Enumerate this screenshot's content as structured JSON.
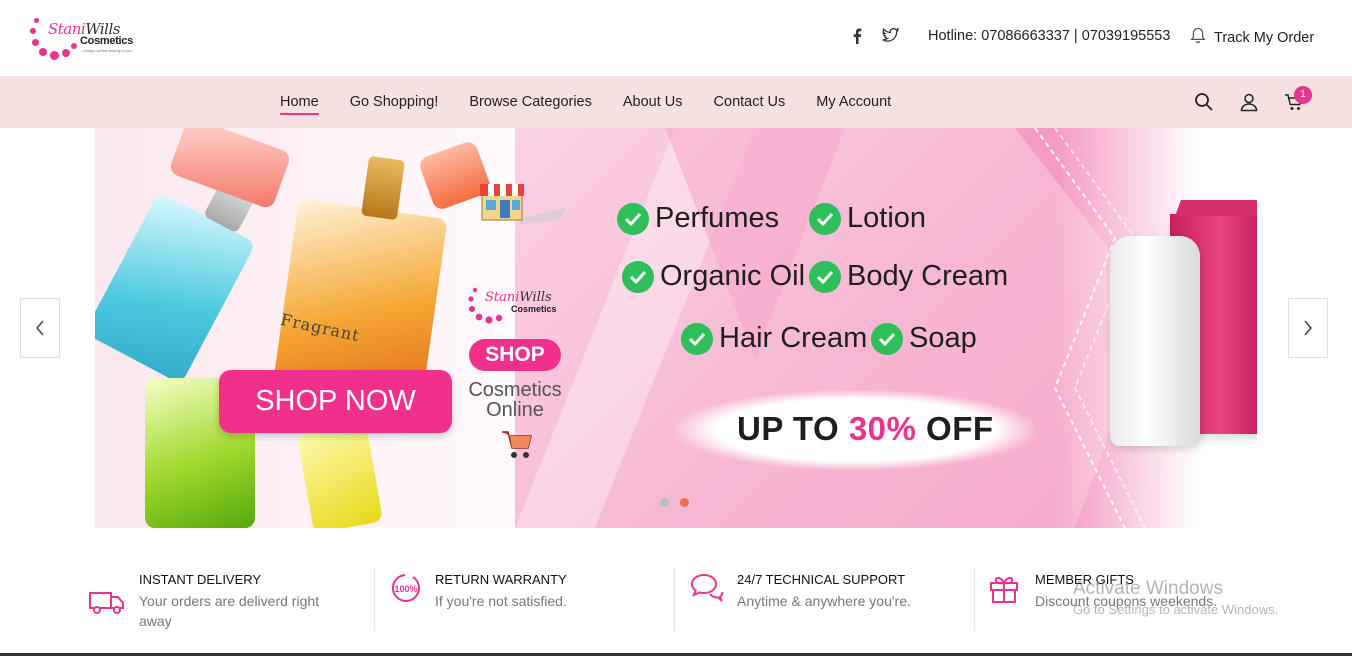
{
  "brand": {
    "name_part1": "Stani",
    "name_part2": "Wills",
    "name_line2": "Cosmetics",
    "tagline": "...brings out the beauty in you",
    "accent_color": "#e8338f"
  },
  "topbar": {
    "social": [
      "facebook-icon",
      "twitter-icon"
    ],
    "hotline": "Hotline: 07086663337 | 07039195553",
    "track_label": "Track My Order"
  },
  "nav": {
    "items": [
      {
        "label": "Home",
        "active": true
      },
      {
        "label": "Go Shopping!"
      },
      {
        "label": "Browse Categories"
      },
      {
        "label": "About Us"
      },
      {
        "label": "Contact Us"
      },
      {
        "label": "My Account"
      }
    ],
    "cart_count": "1"
  },
  "hero": {
    "features": [
      "Perfumes",
      "Lotion",
      "Organic Oil",
      "Body Cream",
      "Hair Cream",
      "Soap"
    ],
    "discount_prefix": "UP TO ",
    "discount_pct": "30%",
    "discount_suffix": " OFF",
    "shop_now": "SHOP NOW",
    "shop_pill": "SHOP",
    "cosmetics_online_line1": "Cosmetics",
    "cosmetics_online_line2": "Online",
    "bottle_label": "Fragrant",
    "slide_count": 2,
    "active_slide": 2
  },
  "features": [
    {
      "title": "INSTANT DELIVERY",
      "subtitle": "Your orders are deliverd right away",
      "icon": "truck-icon"
    },
    {
      "title": "RETURN WARRANTY",
      "subtitle": "If you're not satisfied.",
      "icon": "return-badge-icon"
    },
    {
      "title": "24/7 TECHNICAL SUPPORT",
      "subtitle": "Anytime & anywhere you're.",
      "icon": "chat-bubble-icon"
    },
    {
      "title": "MEMBER GIFTS",
      "subtitle": "Discount coupons weekends.",
      "icon": "gift-icon"
    }
  ],
  "os_watermark": {
    "line1": "Activate Windows",
    "line2": "Go to Settings to activate Windows."
  }
}
